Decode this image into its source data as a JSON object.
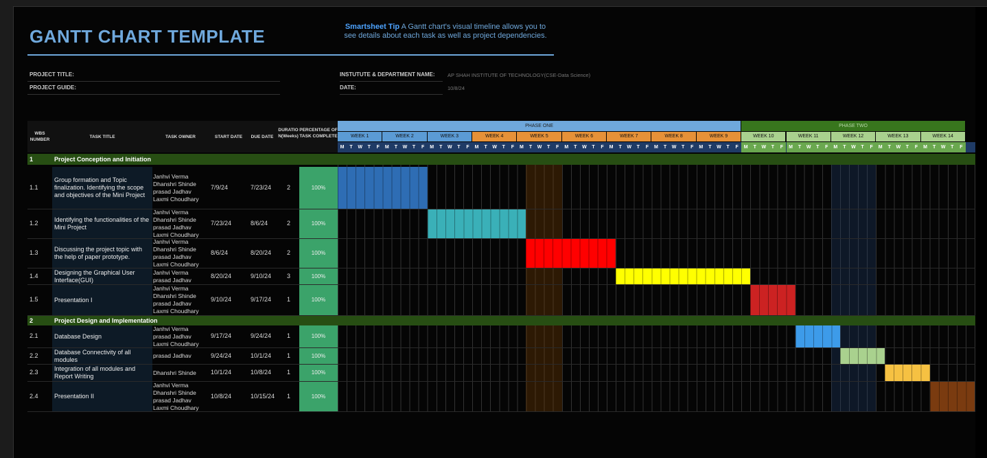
{
  "title": "GANTT CHART TEMPLATE",
  "tip": {
    "label": "Smartsheet Tip",
    "text": "A Gantt chart's visual timeline allows you to see details about each task as well as project dependencies."
  },
  "project": {
    "title_label": "PROJECT TITLE:",
    "title_value": "",
    "guide_label": "PROJECT GUIDE:",
    "guide_value": "",
    "institute_label": "INSTUTUTE & DEPARTMENT NAME:",
    "institute_value": "AP SHAH INSTITUTE OF TECHNOLOGY(CSE-Data Science)",
    "date_label": "DATE:",
    "date_value": "10/8/24"
  },
  "headers": {
    "wbs": "WBS NUMBER",
    "task": "TASK TITLE",
    "owner": "TASK OWNER",
    "start": "START DATE",
    "due": "DUE DATE",
    "duration": "DURATION(Weeks)",
    "percent": "PERCENTAGE OF TASK COMPLETE"
  },
  "phases": [
    {
      "label": "PHASE ONE",
      "color": "#6fa8dc"
    },
    {
      "label": "PHASE TWO",
      "color": "#38761d"
    }
  ],
  "weeks": [
    {
      "label": "WEEK 1",
      "color": "#5b9bd5"
    },
    {
      "label": "WEEK 2",
      "color": "#5b9bd5"
    },
    {
      "label": "WEEK 3",
      "color": "#5b9bd5"
    },
    {
      "label": "WEEK 4",
      "color": "#e69138"
    },
    {
      "label": "WEEK 5",
      "color": "#e69138"
    },
    {
      "label": "WEEK 6",
      "color": "#e69138"
    },
    {
      "label": "WEEK 7",
      "color": "#e69138"
    },
    {
      "label": "WEEK 8",
      "color": "#e69138"
    },
    {
      "label": "WEEK 9",
      "color": "#e69138"
    },
    {
      "label": "WEEK 10",
      "color": "#a9d18e"
    },
    {
      "label": "WEEK 11",
      "color": "#a9d18e"
    },
    {
      "label": "WEEK 12",
      "color": "#a9d18e"
    },
    {
      "label": "WEEK 13",
      "color": "#a9d18e"
    },
    {
      "label": "WEEK 14",
      "color": "#a9d18e"
    }
  ],
  "day_letters": [
    "M",
    "T",
    "W",
    "T",
    "F"
  ],
  "sections": [
    {
      "number": "1",
      "title": "Project Conception and Initiation"
    },
    {
      "number": "2",
      "title": "Project Design and Implementation"
    }
  ],
  "tasks": [
    {
      "wbs": "1.1",
      "title": "Group formation and Topic finalization.  Identifying the scope and objectives of the Mini Project",
      "owner": "Janhvi Verma\nDhanshri Shinde\nprasad Jadhav\nLaxmi Choudhary",
      "start": "7/9/24",
      "due": "7/23/24",
      "duration": "2",
      "percent": "100%",
      "bar_color": "#2e6db4"
    },
    {
      "wbs": "1.2",
      "title": "Identifying the functionalities of the Mini Project",
      "owner": "Janhvi Verma\nDhanshri Shinde\nprasad Jadhav\nLaxmi Choudhary",
      "start": "7/23/24",
      "due": "8/6/24",
      "duration": "2",
      "percent": "100%",
      "bar_color": "#3ab0b8"
    },
    {
      "wbs": "1.3",
      "title": "Discussing the project topic with the help of paper prototype.",
      "owner": "Janhvi Verma\nDhanshri Shinde\nprasad Jadhav\nLaxmi Choudhary",
      "start": "8/6/24",
      "due": "8/20/24",
      "duration": "2",
      "percent": "100%",
      "bar_color": "#ff0000"
    },
    {
      "wbs": "1.4",
      "title": "Designing the Graphical User Interface(GUI)",
      "owner": "Janhvi Verma\nprasad Jadhav",
      "start": "8/20/24",
      "due": "9/10/24",
      "duration": "3",
      "percent": "100%",
      "bar_color": "#ffff00"
    },
    {
      "wbs": "1.5",
      "title": "Presentation I",
      "owner": "Janhvi Verma\nDhanshri Shinde\nprasad Jadhav\nLaxmi Choudhary",
      "start": "9/10/24",
      "due": "9/17/24",
      "duration": "1",
      "percent": "100%",
      "bar_color": "#cc2222"
    },
    {
      "wbs": "2.1",
      "title": "Database Design",
      "owner": "Janhvi Verma\nprasad Jadhav\nLaxmi Choudhary",
      "start": "9/17/24",
      "due": "9/24/24",
      "duration": "1",
      "percent": "100%",
      "bar_color": "#3d9be9"
    },
    {
      "wbs": "2.2",
      "title": "Database Connectivity of all modules",
      "owner": "prasad Jadhav",
      "start": "9/24/24",
      "due": "10/1/24",
      "duration": "1",
      "percent": "100%",
      "bar_color": "#a9d18e"
    },
    {
      "wbs": "2.3",
      "title": "Integration of all modules and Report Writing",
      "owner": "Dhanshri Shinde",
      "start": "10/1/24",
      "due": "10/8/24",
      "duration": "1",
      "percent": "100%",
      "bar_color": "#f6c142"
    },
    {
      "wbs": "2.4",
      "title": "Presentation II",
      "owner": "Janhvi Verma\nDhanshri Shinde\nprasad Jadhav\nLaxmi Choudhary",
      "start": "10/8/24",
      "due": "10/15/24",
      "duration": "1",
      "percent": "100%",
      "bar_color": "#7a3b10"
    }
  ]
}
